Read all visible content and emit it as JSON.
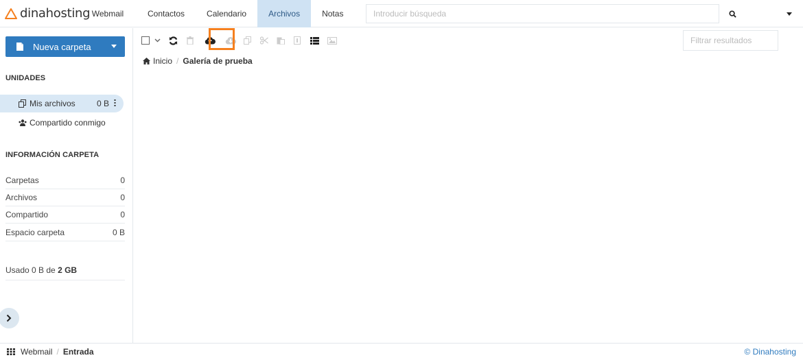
{
  "brand": {
    "name": "dinahosting",
    "accent": "#f5801f"
  },
  "nav": {
    "webmail": "Webmail",
    "tabs": [
      {
        "label": "Contactos",
        "active": false
      },
      {
        "label": "Calendario",
        "active": false
      },
      {
        "label": "Archivos",
        "active": true
      },
      {
        "label": "Notas",
        "active": false
      }
    ]
  },
  "search": {
    "placeholder": "Introducir búsqueda",
    "icon": "search-icon"
  },
  "sidebar": {
    "new_folder": "Nueva carpeta",
    "units_title": "UNIDADES",
    "units": [
      {
        "label": "Mis archivos",
        "size": "0 B",
        "icon": "copy-files-icon"
      },
      {
        "label": "Compartido conmigo",
        "icon": "users-icon"
      }
    ],
    "info_title": "INFORMACIÓN CARPETA",
    "info": [
      {
        "label": "Carpetas",
        "value": "0"
      },
      {
        "label": "Archivos",
        "value": "0"
      },
      {
        "label": "Compartido",
        "value": "0"
      },
      {
        "label": "Espacio carpeta",
        "value": "0 B"
      }
    ],
    "usage_prefix": "Usado 0 B de",
    "usage_total": "2 GB"
  },
  "toolbar": {
    "icons": [
      "checkbox-icon",
      "chevron-down-icon",
      "refresh-icon",
      "trash-icon",
      "upload-icon",
      "download-icon",
      "copy-icon",
      "cut-icon",
      "paste-icon",
      "rename-icon",
      "list-view-icon",
      "gallery-view-icon"
    ],
    "highlighted": "upload-icon",
    "filter_placeholder": "Filtrar resultados"
  },
  "breadcrumb": {
    "home": "Inicio",
    "current": "Galería de prueba"
  },
  "footer": {
    "app": "Webmail",
    "folder": "Entrada",
    "copyright": "© Dinahosting"
  }
}
